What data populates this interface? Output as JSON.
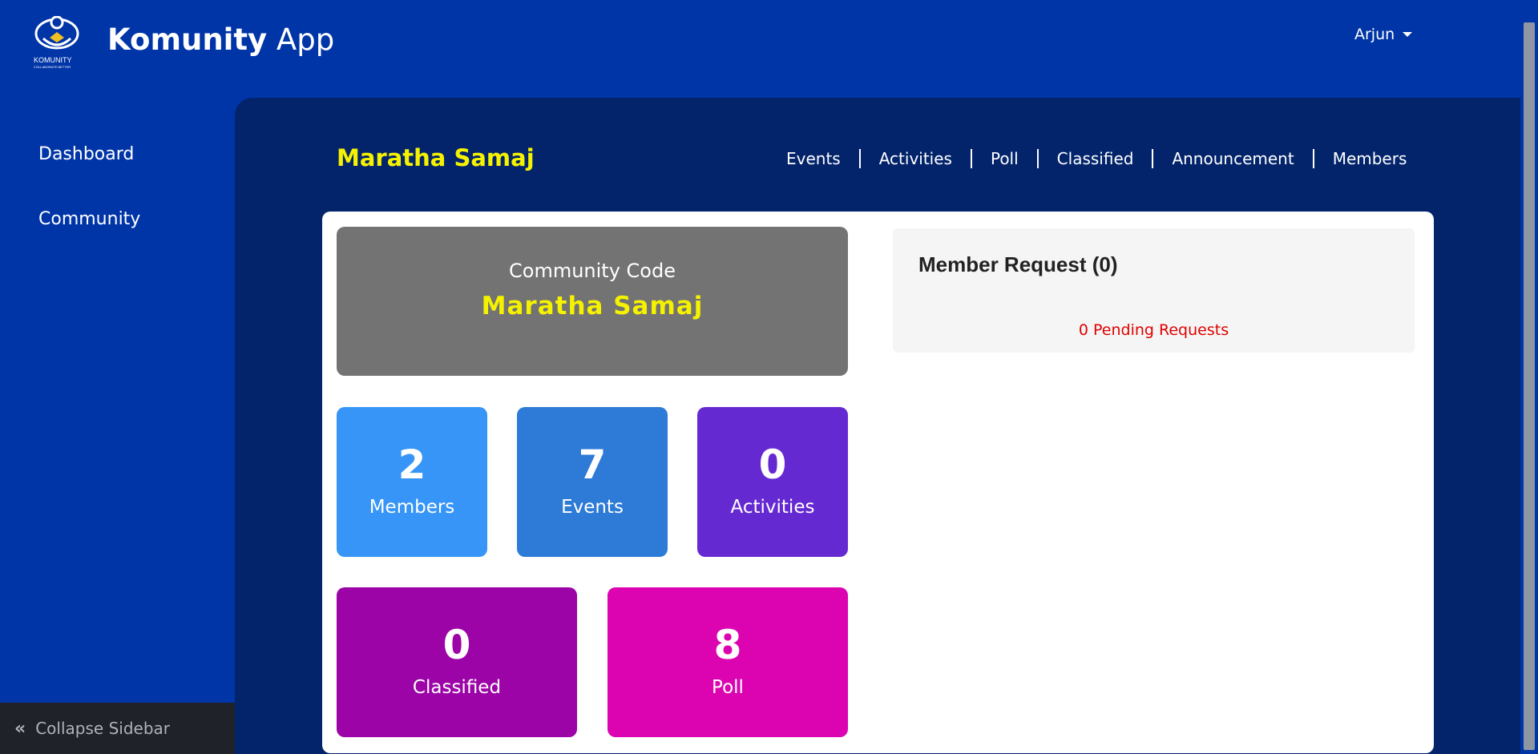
{
  "header": {
    "logo_text": "KOMUNITY",
    "logo_tagline": "COLLABORATE BETTER",
    "title_bold": "Komunity",
    "title_rest": " App",
    "user_name": "Arjun"
  },
  "sidebar": {
    "items": [
      {
        "label": "Dashboard"
      },
      {
        "label": "Community"
      }
    ],
    "collapse_label": "Collapse Sidebar"
  },
  "community": {
    "name": "Maratha Samaj",
    "tabs": [
      "Events",
      "Activities",
      "Poll",
      "Classified",
      "Announcement",
      "Members"
    ],
    "code_label": "Community Code",
    "code_value": "Maratha Samaj"
  },
  "stats": [
    {
      "value": "2",
      "label": "Members",
      "color": "#3695f6"
    },
    {
      "value": "7",
      "label": "Events",
      "color": "#2d7bd7"
    },
    {
      "value": "0",
      "label": "Activities",
      "color": "#6529d2"
    },
    {
      "value": "0",
      "label": "Classified",
      "color": "#9c04a7"
    },
    {
      "value": "8",
      "label": "Poll",
      "color": "#dc04b0"
    }
  ],
  "member_request": {
    "title": "Member Request (0)",
    "pending_text": "0 Pending Requests"
  },
  "colors": {
    "background": "#0035a8",
    "content": "#03246b",
    "accent_yellow": "#f5f200",
    "pending_red": "#e00000"
  }
}
